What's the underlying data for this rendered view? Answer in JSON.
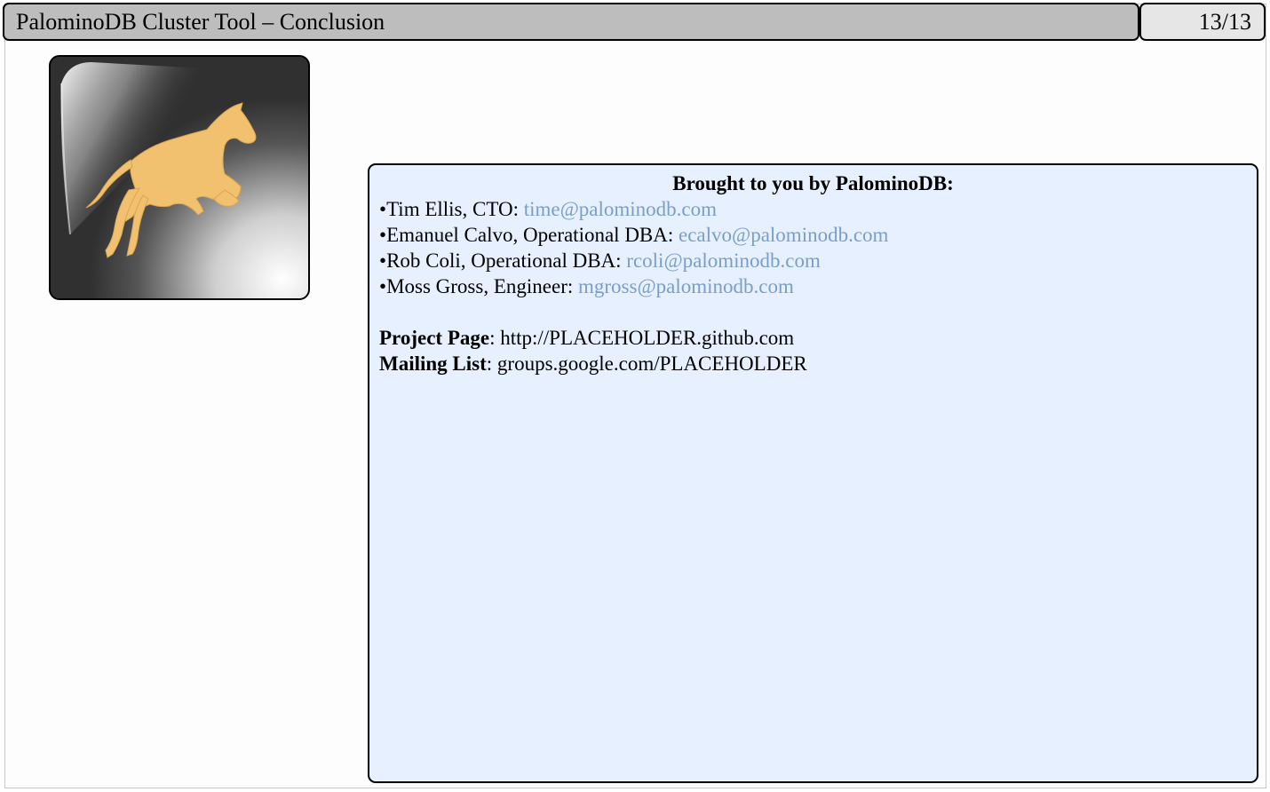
{
  "header": {
    "title": "PalominoDB Cluster Tool – Conclusion",
    "page_number": "13/13"
  },
  "logo": {
    "icon": "horse-logo-icon"
  },
  "contact_box": {
    "heading": "Brought to you by PalominoDB:",
    "people": [
      {
        "bullet": "•",
        "text": "Tim Ellis, CTO: ",
        "email": "time@palominodb.com"
      },
      {
        "bullet": "•",
        "text": "Emanuel Calvo, Operational DBA: ",
        "email": "ecalvo@palominodb.com"
      },
      {
        "bullet": "•",
        "text": "Rob Coli, Operational DBA: ",
        "email": "rcoli@palominodb.com"
      },
      {
        "bullet": "•",
        "text": "Moss Gross, Engineer: ",
        "email": "mgross@palominodb.com"
      }
    ],
    "project_page_label": "Project Page",
    "project_page_value": ": http://PLACEHOLDER.github.com",
    "mailing_list_label": "Mailing List",
    "mailing_list_value": ": groups.google.com/PLACEHOLDER"
  },
  "colors": {
    "title_bar_bg": "#bdbdbd",
    "page_box_bg": "#e6e6e6",
    "contact_box_bg": "#e6f0ff",
    "email_link": "#7a9ec8",
    "horse": "#f2c170"
  }
}
